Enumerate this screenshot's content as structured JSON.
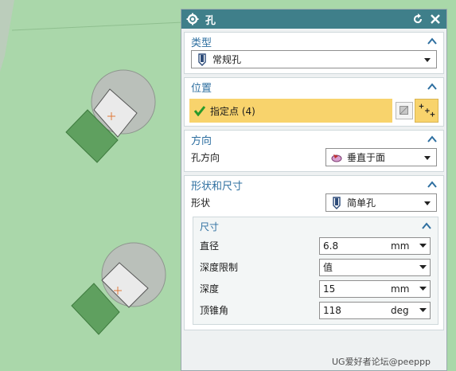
{
  "dialog": {
    "title": "孔",
    "type_section": {
      "header": "类型",
      "selected": "常规孔"
    },
    "position_section": {
      "header": "位置",
      "field_label": "指定点 (4)"
    },
    "direction_section": {
      "header": "方向",
      "label": "孔方向",
      "selected": "垂直于面"
    },
    "shape_section": {
      "header": "形状和尺寸",
      "shape_label": "形状",
      "shape_selected": "简单孔",
      "dimensions": {
        "header": "尺寸",
        "rows": [
          {
            "label": "直径",
            "value": "6.8",
            "unit": "mm"
          },
          {
            "label": "深度限制",
            "value": "值",
            "unit": ""
          },
          {
            "label": "深度",
            "value": "15",
            "unit": "mm"
          },
          {
            "label": "顶锥角",
            "value": "118",
            "unit": "deg"
          }
        ]
      }
    }
  },
  "watermark": "UG爱好者论坛@peeppp",
  "colors": {
    "titlebar": "#3f7f8a",
    "section_header_text": "#2e6fa0",
    "highlight": "#f8d36c",
    "viewport_bg": "#a9d8a9"
  }
}
